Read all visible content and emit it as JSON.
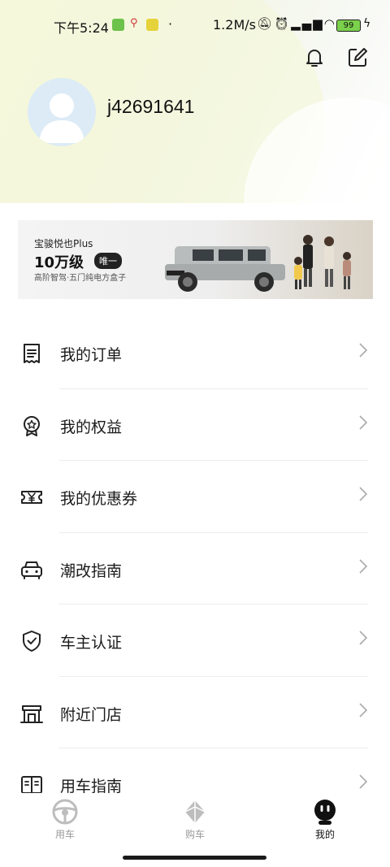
{
  "status_bar": {
    "time": "下午5:24",
    "network_speed": "1.2M/s",
    "battery_level": "99"
  },
  "profile": {
    "username": "j42691641"
  },
  "banner": {
    "brand": "宝骏悦也Plus",
    "price": "10万级",
    "tag": "唯一",
    "subtitle": "高阶智驾·五门纯电方盒子"
  },
  "menu": [
    {
      "label": "我的订单",
      "icon": "receipt-icon"
    },
    {
      "label": "我的权益",
      "icon": "badge-star-icon"
    },
    {
      "label": "我的优惠券",
      "icon": "coupon-yen-icon"
    },
    {
      "label": "潮改指南",
      "icon": "car-front-icon"
    },
    {
      "label": "车主认证",
      "icon": "shield-check-icon"
    },
    {
      "label": "附近门店",
      "icon": "store-icon"
    },
    {
      "label": "用车指南",
      "icon": "book-icon"
    }
  ],
  "tabbar": {
    "tabs": [
      {
        "label": "用车",
        "icon": "steering-wheel-icon",
        "active": false
      },
      {
        "label": "购车",
        "icon": "diamond-logo-icon",
        "active": false
      },
      {
        "label": "我的",
        "icon": "robot-face-icon",
        "active": true
      }
    ]
  },
  "colors": {
    "accent": "#111111",
    "inactive_tab": "#999999",
    "hero_bg": "#f4f7e4"
  }
}
